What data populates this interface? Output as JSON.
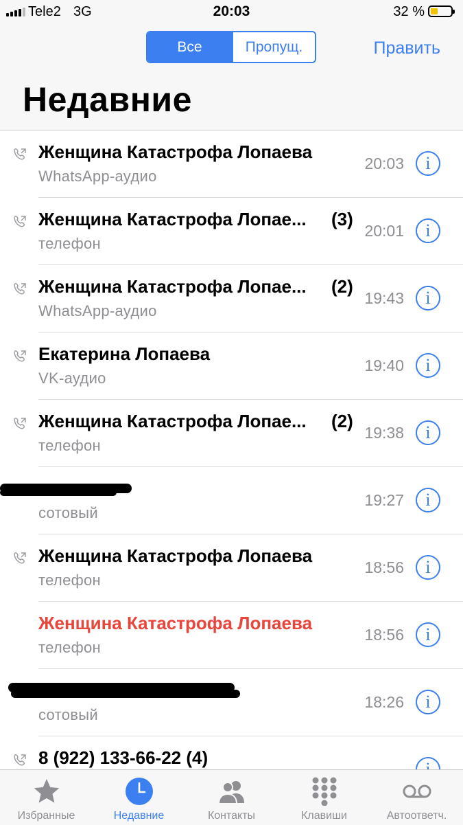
{
  "status_bar": {
    "carrier": "Tele2",
    "network": "3G",
    "time": "20:03",
    "battery_percent": "32 %"
  },
  "header": {
    "segments": [
      "Все",
      "Пропущ."
    ],
    "selected_segment": "Все",
    "edit_label": "Править",
    "title": "Недавние"
  },
  "calls": [
    {
      "name": "Женщина Катастрофа Лопаева",
      "count": "",
      "type": "WhatsApp-аудио",
      "time": "20:03",
      "missed": false,
      "outgoing": true
    },
    {
      "name": "Женщина Катастрофа Лопае...",
      "count": "(3)",
      "type": "телефон",
      "time": "20:01",
      "missed": false,
      "outgoing": true
    },
    {
      "name": "Женщина Катастрофа Лопае...",
      "count": "(2)",
      "type": "WhatsApp-аудио",
      "time": "19:43",
      "missed": false,
      "outgoing": true
    },
    {
      "name": "Екатерина Лопаева",
      "count": "",
      "type": "VK-аудио",
      "time": "19:40",
      "missed": false,
      "outgoing": true
    },
    {
      "name": "Женщина Катастрофа Лопае...",
      "count": "(2)",
      "type": "телефон",
      "time": "19:38",
      "missed": false,
      "outgoing": true
    },
    {
      "name": "",
      "count": "",
      "type": "сотовый",
      "time": "19:27",
      "missed": false,
      "outgoing": true,
      "redacted": true
    },
    {
      "name": "Женщина Катастрофа Лопаева",
      "count": "",
      "type": "телефон",
      "time": "18:56",
      "missed": false,
      "outgoing": true
    },
    {
      "name": "Женщина Катастрофа Лопаева",
      "count": "",
      "type": "телефон",
      "time": "18:56",
      "missed": true,
      "outgoing": false
    },
    {
      "name": "",
      "count": "",
      "type": "сотовый",
      "time": "18:26",
      "missed": false,
      "outgoing": true,
      "redacted": true
    },
    {
      "name": "8 (922) 133-66-22 (4)",
      "count": "",
      "type": "",
      "time": "",
      "missed": false,
      "outgoing": true
    }
  ],
  "tab_bar": {
    "tabs": [
      {
        "label": "Избранные",
        "icon": "star-icon"
      },
      {
        "label": "Недавние",
        "icon": "clock-icon"
      },
      {
        "label": "Контакты",
        "icon": "contacts-icon"
      },
      {
        "label": "Клавиши",
        "icon": "keypad-icon"
      },
      {
        "label": "Автоответч.",
        "icon": "voicemail-icon"
      }
    ],
    "active_tab": "Недавние"
  },
  "colors": {
    "accent": "#3b7ff0",
    "missed": "#e8453c",
    "secondary_text": "#8e8e93"
  }
}
